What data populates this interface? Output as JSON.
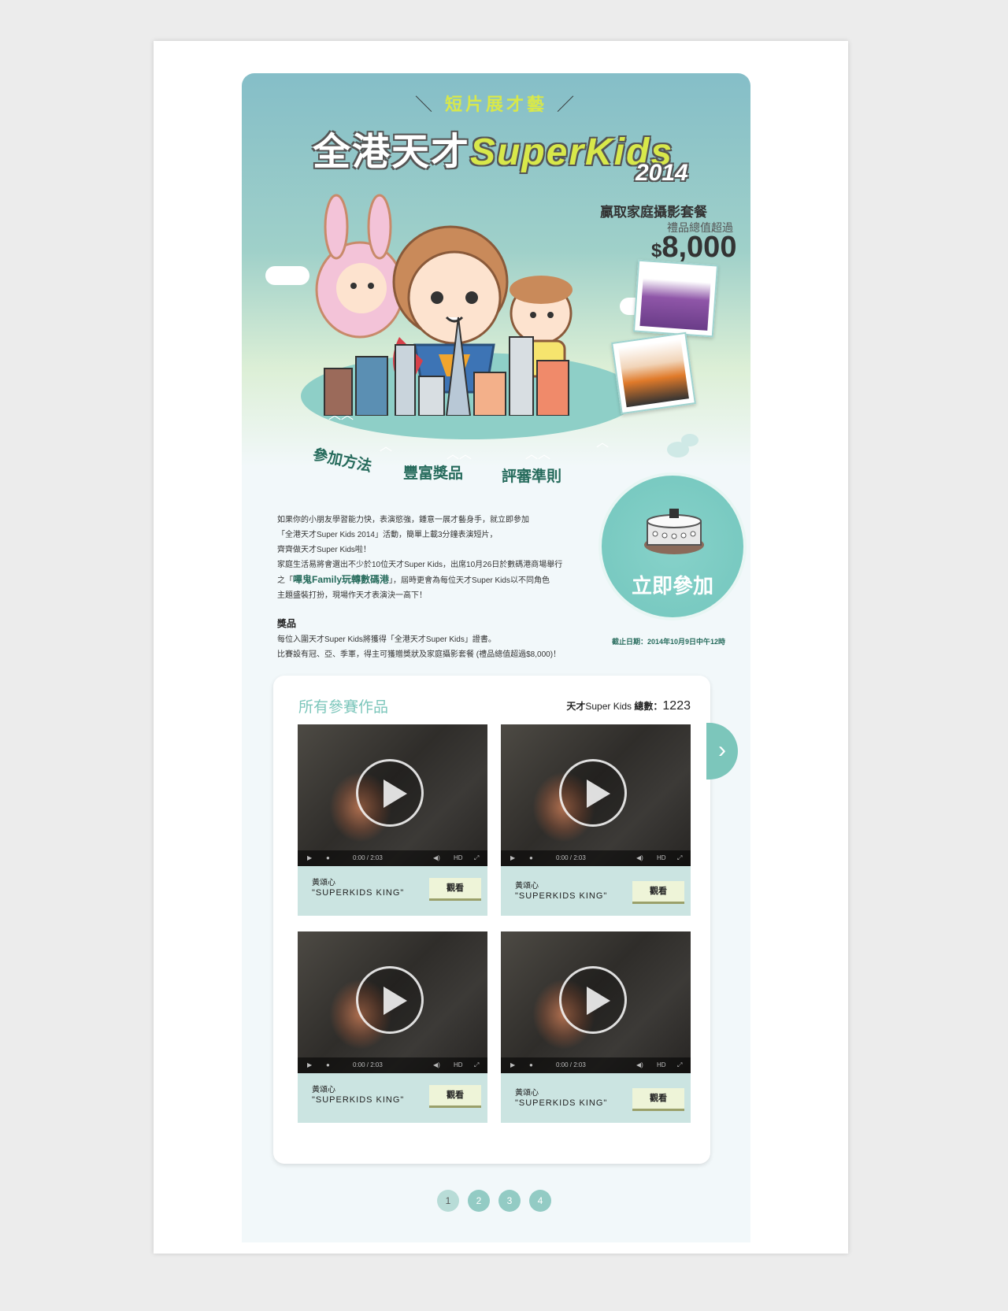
{
  "hero": {
    "tagline": "短片展才藝",
    "title_cn": "全港天才",
    "title_en": "SuperKids",
    "year": "2014",
    "prize_title": "贏取家庭攝影套餐",
    "prize_sub": "禮品總值超過",
    "prize_currency": "$",
    "prize_amount": "8,000"
  },
  "tabs": [
    {
      "label": "參加方法"
    },
    {
      "label": "豐富獎品"
    },
    {
      "label": "評審準則"
    }
  ],
  "join": {
    "label": "立即參加"
  },
  "intro": {
    "line1": "如果你的小朋友學習能力快，表演慾強，鍾意一展才藝身手，就立即參加",
    "line2": "「全港天才Super Kids 2014」活動，簡單上載3分鐘表演短片，",
    "line3": "齊齊做天才Super Kids啦！",
    "line4": "家庭生活易將會選出不少於10位天才Super Kids，出席10月26日於數碼港商場舉行",
    "line5_pre": "之「",
    "line5_hl": "嗶鬼Family玩轉數碼港",
    "line5_post": "」，屆時更會為每位天才Super Kids以不同角色",
    "line6": "主題盛裝打扮，現場作天才表演決一高下！"
  },
  "prize": {
    "heading": "獎品",
    "line1": "每位入圍天才Super Kids將獲得「全港天才Super Kids」證書。",
    "line2": "比賽設有冠、亞、季軍，得主可獲贈獎狀及家庭攝影套餐 (禮品總值超過$8,000)！"
  },
  "deadline": "截止日期：2014年10月9日中午12時",
  "entries": {
    "title": "所有參賽作品",
    "total_label_pre": "天才",
    "total_label_mid": "Super Kids",
    "total_label_post": "總數：",
    "total_count": "1223",
    "cards": [
      {
        "name": "黃頌心",
        "subtitle": "\"SUPERKIDS KING\"",
        "watch": "觀看",
        "time": "0:00 / 2:03",
        "hd": "HD"
      },
      {
        "name": "黃頌心",
        "subtitle": "\"SUPERKIDS KING\"",
        "watch": "觀看",
        "time": "0:00 / 2:03",
        "hd": "HD"
      },
      {
        "name": "黃頌心",
        "subtitle": "\"SUPERKIDS KING\"",
        "watch": "觀看",
        "time": "0:00 / 2:03",
        "hd": "HD"
      },
      {
        "name": "黃頌心",
        "subtitle": "\"SUPERKIDS KING\"",
        "watch": "觀看",
        "time": "0:00 / 2:03",
        "hd": "HD"
      }
    ]
  },
  "pager": [
    "1",
    "2",
    "3",
    "4"
  ],
  "icons": {
    "next": "chevron-right-icon",
    "play": "play-icon"
  },
  "colors": {
    "accent": "#7cc6bb",
    "dark_green": "#266b5c",
    "title_yellow": "#d8e84a"
  }
}
